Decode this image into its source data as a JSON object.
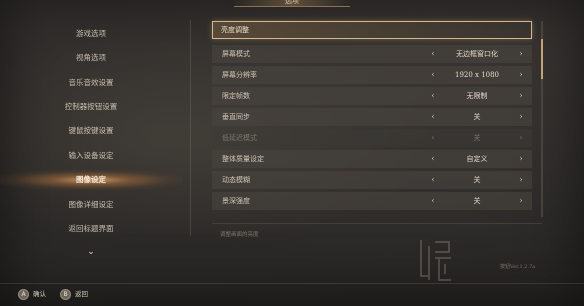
{
  "window": {
    "title": "选项"
  },
  "sidebar": {
    "items": [
      {
        "label": "游戏选项",
        "active": false
      },
      {
        "label": "视角选项",
        "active": false
      },
      {
        "label": "音乐音效设置",
        "active": false
      },
      {
        "label": "控制器按钮设置",
        "active": false
      },
      {
        "label": "键鼠按键设置",
        "active": false
      },
      {
        "label": "输入设备设定",
        "active": false
      },
      {
        "label": "图像设定",
        "active": true
      },
      {
        "label": "图像详细设定",
        "active": false
      },
      {
        "label": "返回标题界面",
        "active": false
      }
    ],
    "more_icon": "chevron-down-icon",
    "more_glyph": "⌄"
  },
  "settings": {
    "header": {
      "label": "亮度调整"
    },
    "rows": [
      {
        "label": "屏幕模式",
        "value": "无边框窗口化",
        "enabled": true
      },
      {
        "label": "屏幕分辨率",
        "value": "1920 x 1080",
        "enabled": true
      },
      {
        "label": "限定帧数",
        "value": "无限制",
        "enabled": true
      },
      {
        "label": "垂直同步",
        "value": "关",
        "enabled": true
      },
      {
        "label": "低延迟模式",
        "value": "关",
        "enabled": false
      },
      {
        "label": "整体质量设定",
        "value": "自定义",
        "enabled": true
      },
      {
        "label": "动态模糊",
        "value": "关",
        "enabled": true
      },
      {
        "label": "景深强度",
        "value": "关",
        "enabled": true
      }
    ],
    "arrow_left": "‹",
    "arrow_right": "›",
    "description": "调整画面的亮度",
    "scroll_fraction": 0.0
  },
  "version_text": "按钮Ver.1.2.7a",
  "footer": {
    "buttons": [
      {
        "key": "A",
        "label": "确认",
        "icon": "confirm-key-icon"
      },
      {
        "key": "B",
        "label": "返回",
        "icon": "back-key-icon"
      }
    ]
  },
  "colors": {
    "accent": "#d6b88a",
    "active_glow": "#e0aa6e",
    "text": "#d2c8b8",
    "disabled_text": "#7d776d"
  }
}
